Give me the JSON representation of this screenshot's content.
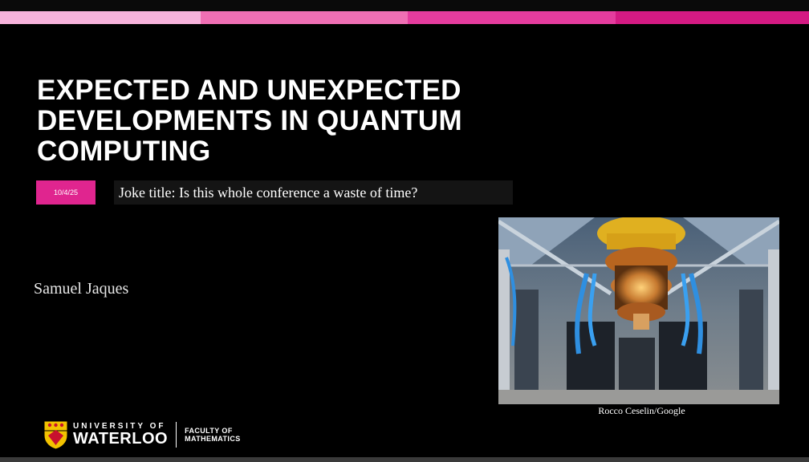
{
  "slide": {
    "title": "EXPECTED AND UNEXPECTED DEVELOPMENTS IN QUANTUM COMPUTING",
    "date": "10/4/25",
    "subtitle": "Joke title: Is this whole conference a waste of time?",
    "author": "Samuel Jaques",
    "photo_caption": "Rocco Ceselin/Google",
    "photo_subject": "quantum-computer-cryostat-photo"
  },
  "logo": {
    "university_small": "UNIVERSITY OF",
    "university_big": "WATERLOO",
    "faculty_line1": "FACULTY OF",
    "faculty_line2": "MATHEMATICS"
  },
  "colors": {
    "stripe_1": "#f7b3dc",
    "stripe_2": "#f06fb4",
    "stripe_3": "#e53c9e",
    "stripe_4": "#d41a83",
    "date_badge": "#e0258f",
    "background": "#000000"
  }
}
